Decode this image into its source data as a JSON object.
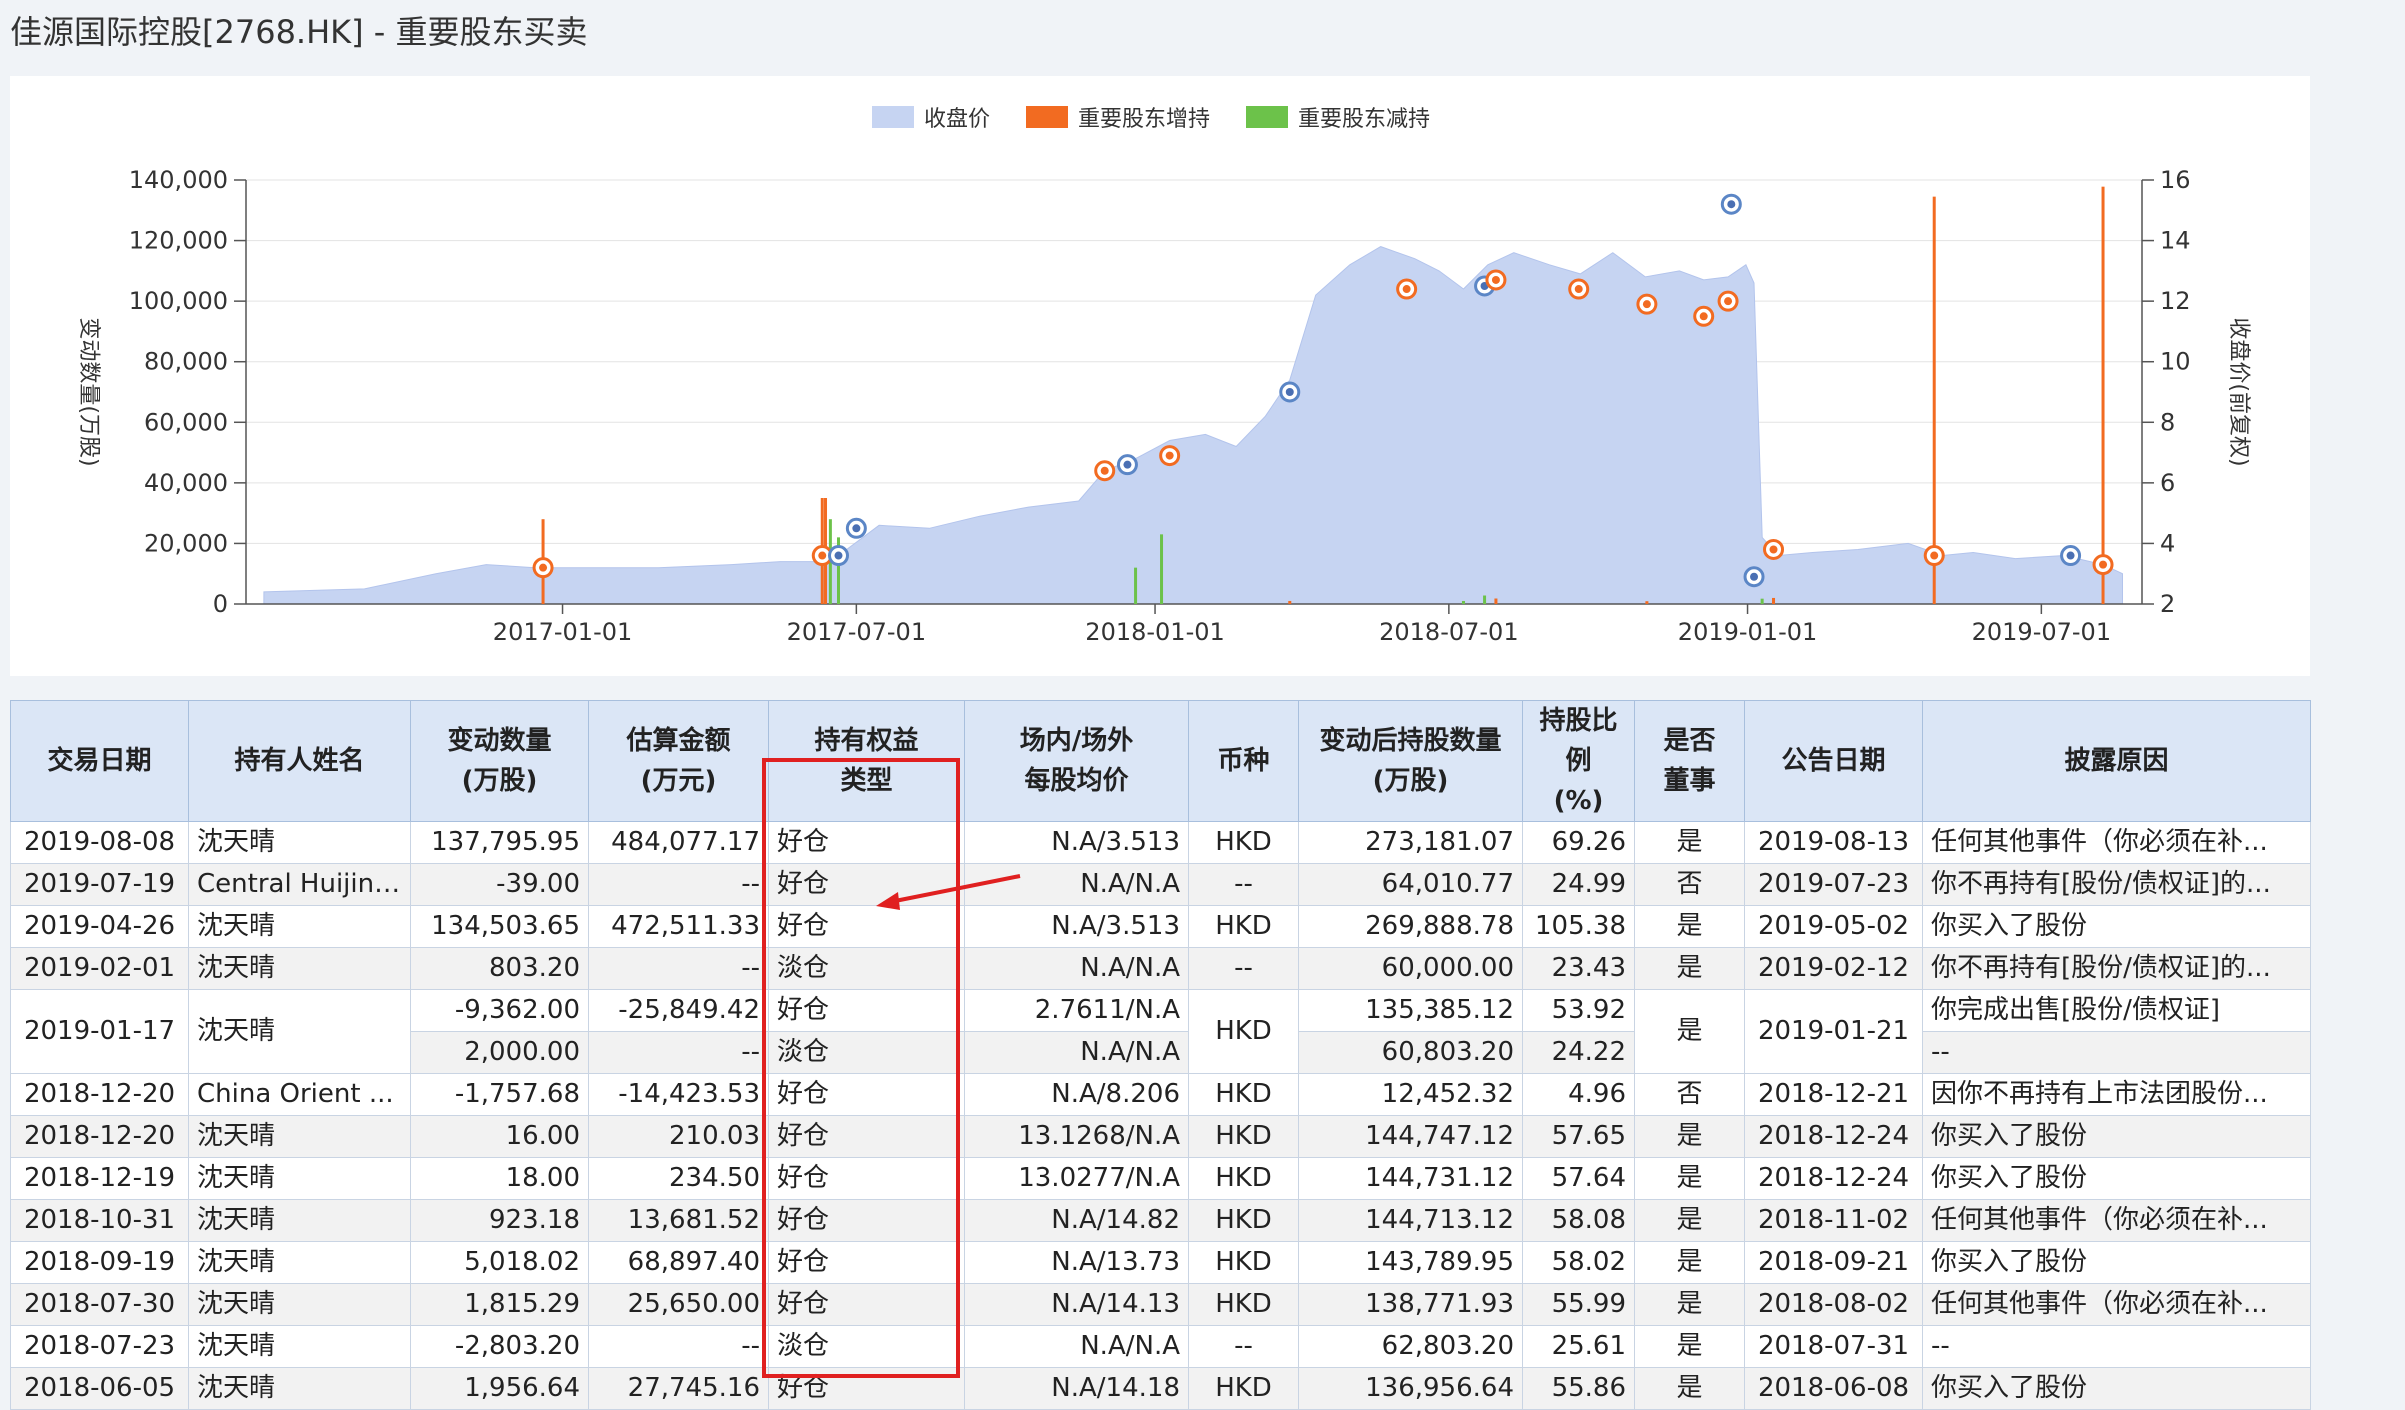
{
  "page": {
    "title": "佳源国际控股[2768.HK] - 重要股东买卖"
  },
  "colors": {
    "close": "#c6d4f2",
    "increase": "#f26b21",
    "decrease": "#6cc24a",
    "accent": "#e02020"
  },
  "chart_data": {
    "type": "area",
    "legend": [
      "收盘价",
      "重要股东增持",
      "重要股东减持"
    ],
    "legend_position": "top-center",
    "ylabel_left": "变动数量(万股)",
    "ylabel_right": "收盘价(前复权)",
    "y_left_ticks": [
      "0",
      "20,000",
      "40,000",
      "60,000",
      "80,000",
      "100,000",
      "120,000",
      "140,000"
    ],
    "y_right_ticks": [
      "2",
      "4",
      "6",
      "8",
      "10",
      "12",
      "14",
      "16"
    ],
    "x_ticks": [
      "2017-01-01",
      "2017-07-01",
      "2018-01-01",
      "2018-07-01",
      "2019-01-01",
      "2019-07-01"
    ],
    "ylim_left": [
      0,
      140000
    ],
    "ylim_right": [
      2,
      16
    ],
    "grid": true,
    "close_price": {
      "name": "收盘价",
      "x": [
        "2016-07-01",
        "2016-09-01",
        "2016-10-15",
        "2016-11-15",
        "2016-12-15",
        "2017-01-15",
        "2017-03-01",
        "2017-04-15",
        "2017-05-15",
        "2017-06-15",
        "2017-07-15",
        "2017-08-15",
        "2017-09-15",
        "2017-10-15",
        "2017-11-15",
        "2017-12-01",
        "2017-12-20",
        "2018-01-10",
        "2018-02-01",
        "2018-02-20",
        "2018-03-10",
        "2018-03-25",
        "2018-04-10",
        "2018-05-01",
        "2018-05-20",
        "2018-06-10",
        "2018-06-25",
        "2018-07-10",
        "2018-07-25",
        "2018-08-10",
        "2018-09-01",
        "2018-09-20",
        "2018-10-10",
        "2018-10-30",
        "2018-11-20",
        "2018-12-05",
        "2018-12-20",
        "2018-12-31",
        "2019-01-05",
        "2019-01-10",
        "2019-01-20",
        "2019-02-10",
        "2019-03-10",
        "2019-04-10",
        "2019-05-01",
        "2019-05-20",
        "2019-06-15",
        "2019-07-15",
        "2019-08-08",
        "2019-08-20"
      ],
      "values": [
        2.4,
        2.5,
        3.0,
        3.3,
        3.2,
        3.2,
        3.2,
        3.3,
        3.4,
        3.4,
        4.6,
        4.5,
        4.9,
        5.2,
        5.4,
        6.4,
        6.8,
        7.4,
        7.6,
        7.2,
        8.2,
        9.4,
        12.2,
        13.2,
        13.8,
        13.4,
        13.0,
        12.4,
        13.2,
        13.6,
        13.2,
        12.9,
        13.6,
        12.8,
        13.0,
        12.7,
        12.8,
        13.2,
        12.6,
        4.2,
        3.6,
        3.7,
        3.8,
        4.0,
        3.6,
        3.7,
        3.5,
        3.6,
        3.3,
        3.0
      ]
    },
    "increase_bars": {
      "name": "重要股东增持",
      "x": [
        "2016-12-20",
        "2017-06-10",
        "2017-06-12",
        "2018-03-25",
        "2018-07-30",
        "2018-10-31",
        "2019-01-17",
        "2019-04-26",
        "2019-08-08"
      ],
      "values": [
        28000,
        35000,
        35000,
        1000,
        1815.29,
        923.18,
        2000,
        134503.65,
        137795.95
      ]
    },
    "decrease_bars": {
      "name": "重要股东减持",
      "x": [
        "2017-06-15",
        "2017-06-20",
        "2017-12-20",
        "2018-01-05",
        "2018-07-23",
        "2018-07-10",
        "2019-01-10"
      ],
      "values": [
        28000,
        22000,
        12000,
        23000,
        2803.2,
        1000,
        1757.68
      ]
    },
    "event_markers": {
      "x": [
        "2016-12-20",
        "2017-06-10",
        "2017-06-20",
        "2017-07-01",
        "2017-12-01",
        "2017-12-15",
        "2018-01-10",
        "2018-03-25",
        "2018-06-05",
        "2018-07-23",
        "2018-07-30",
        "2018-09-19",
        "2018-10-31",
        "2018-12-05",
        "2018-12-20",
        "2018-12-22",
        "2019-01-05",
        "2019-01-17",
        "2019-04-26",
        "2019-07-19",
        "2019-08-08"
      ],
      "y": [
        3.2,
        3.6,
        3.6,
        4.5,
        6.4,
        6.6,
        6.9,
        9.0,
        12.4,
        12.5,
        12.7,
        12.4,
        11.9,
        11.5,
        12.0,
        15.2,
        2.9,
        3.8,
        3.6,
        3.6,
        3.3
      ],
      "kind": [
        "inc",
        "inc",
        "dec",
        "dec",
        "inc",
        "dec",
        "inc",
        "dec",
        "inc",
        "dec",
        "inc",
        "inc",
        "inc",
        "inc",
        "inc",
        "dec",
        "dec",
        "inc",
        "inc",
        "dec",
        "inc"
      ]
    }
  },
  "table": {
    "headers": [
      [
        "交易日期",
        ""
      ],
      [
        "持有人姓名",
        ""
      ],
      [
        "变动数量",
        "(万股)"
      ],
      [
        "估算金额",
        "(万元)"
      ],
      [
        "持有权益",
        "类型"
      ],
      [
        "场内/场外",
        "每股均价"
      ],
      [
        "币种",
        ""
      ],
      [
        "变动后持股数量",
        "(万股)"
      ],
      [
        "持股比例",
        "(%)"
      ],
      [
        "是否",
        "董事"
      ],
      [
        "公告日期",
        ""
      ],
      [
        "披露原因",
        ""
      ]
    ],
    "rows": [
      {
        "date": "2019-08-08",
        "holder": "沈天晴",
        "qty": "137,795.95",
        "amount": "484,077.17",
        "type": "好仓",
        "price": "N.A/3.513",
        "cur": "HKD",
        "after": "273,181.07",
        "pct": "69.26",
        "director": "是",
        "ann": "2019-08-13",
        "reason": "任何其他事件（你必须在补..."
      },
      {
        "date": "2019-07-19",
        "holder": "Central Huijin ...",
        "qty": "-39.00",
        "amount": "--",
        "type": "好仓",
        "price": "N.A/N.A",
        "cur": "--",
        "after": "64,010.77",
        "pct": "24.99",
        "director": "否",
        "ann": "2019-07-23",
        "reason": "你不再持有[股份/债权证]的..."
      },
      {
        "date": "2019-04-26",
        "holder": "沈天晴",
        "qty": "134,503.65",
        "amount": "472,511.33",
        "type": "好仓",
        "price": "N.A/3.513",
        "cur": "HKD",
        "after": "269,888.78",
        "pct": "105.38",
        "director": "是",
        "ann": "2019-05-02",
        "reason": "你买入了股份"
      },
      {
        "date": "2019-02-01",
        "holder": "沈天晴",
        "qty": "803.20",
        "amount": "--",
        "type": "淡仓",
        "price": "N.A/N.A",
        "cur": "--",
        "after": "60,000.00",
        "pct": "23.43",
        "director": "是",
        "ann": "2019-02-12",
        "reason": "你不再持有[股份/债权证]的..."
      },
      {
        "date": "2019-01-17",
        "holder": "沈天晴",
        "qty": "-9,362.00",
        "amount": "-25,849.42",
        "type": "好仓",
        "price": "2.7611/N.A",
        "cur": "HKD",
        "after": "135,385.12",
        "pct": "53.92",
        "director": "是",
        "ann": "2019-01-21",
        "reason": "你完成出售[股份/债权证]"
      },
      {
        "qty": "2,000.00",
        "amount": "--",
        "type": "淡仓",
        "price": "N.A/N.A",
        "after": "60,803.20",
        "pct": "24.22",
        "reason": "--"
      },
      {
        "date": "2018-12-20",
        "holder": "China Orient ...",
        "qty": "-1,757.68",
        "amount": "-14,423.53",
        "type": "好仓",
        "price": "N.A/8.206",
        "cur": "HKD",
        "after": "12,452.32",
        "pct": "4.96",
        "director": "否",
        "ann": "2018-12-21",
        "reason": "因你不再持有上市法团股份..."
      },
      {
        "date": "2018-12-20",
        "holder": "沈天晴",
        "qty": "16.00",
        "amount": "210.03",
        "type": "好仓",
        "price": "13.1268/N.A",
        "cur": "HKD",
        "after": "144,747.12",
        "pct": "57.65",
        "director": "是",
        "ann": "2018-12-24",
        "reason": "你买入了股份"
      },
      {
        "date": "2018-12-19",
        "holder": "沈天晴",
        "qty": "18.00",
        "amount": "234.50",
        "type": "好仓",
        "price": "13.0277/N.A",
        "cur": "HKD",
        "after": "144,731.12",
        "pct": "57.64",
        "director": "是",
        "ann": "2018-12-24",
        "reason": "你买入了股份"
      },
      {
        "date": "2018-10-31",
        "holder": "沈天晴",
        "qty": "923.18",
        "amount": "13,681.52",
        "type": "好仓",
        "price": "N.A/14.82",
        "cur": "HKD",
        "after": "144,713.12",
        "pct": "58.08",
        "director": "是",
        "ann": "2018-11-02",
        "reason": "任何其他事件（你必须在补..."
      },
      {
        "date": "2018-09-19",
        "holder": "沈天晴",
        "qty": "5,018.02",
        "amount": "68,897.40",
        "type": "好仓",
        "price": "N.A/13.73",
        "cur": "HKD",
        "after": "143,789.95",
        "pct": "58.02",
        "director": "是",
        "ann": "2018-09-21",
        "reason": "你买入了股份"
      },
      {
        "date": "2018-07-30",
        "holder": "沈天晴",
        "qty": "1,815.29",
        "amount": "25,650.00",
        "type": "好仓",
        "price": "N.A/14.13",
        "cur": "HKD",
        "after": "138,771.93",
        "pct": "55.99",
        "director": "是",
        "ann": "2018-08-02",
        "reason": "任何其他事件（你必须在补..."
      },
      {
        "date": "2018-07-23",
        "holder": "沈天晴",
        "qty": "-2,803.20",
        "amount": "--",
        "type": "淡仓",
        "price": "N.A/N.A",
        "cur": "--",
        "after": "62,803.20",
        "pct": "25.61",
        "director": "是",
        "ann": "2018-07-31",
        "reason": "--"
      },
      {
        "date": "2018-06-05",
        "holder": "沈天晴",
        "qty": "1,956.64",
        "amount": "27,745.16",
        "type": "好仓",
        "price": "N.A/14.18",
        "cur": "HKD",
        "after": "136,956.64",
        "pct": "55.86",
        "director": "是",
        "ann": "2018-06-08",
        "reason": "你买入了股份"
      }
    ]
  }
}
